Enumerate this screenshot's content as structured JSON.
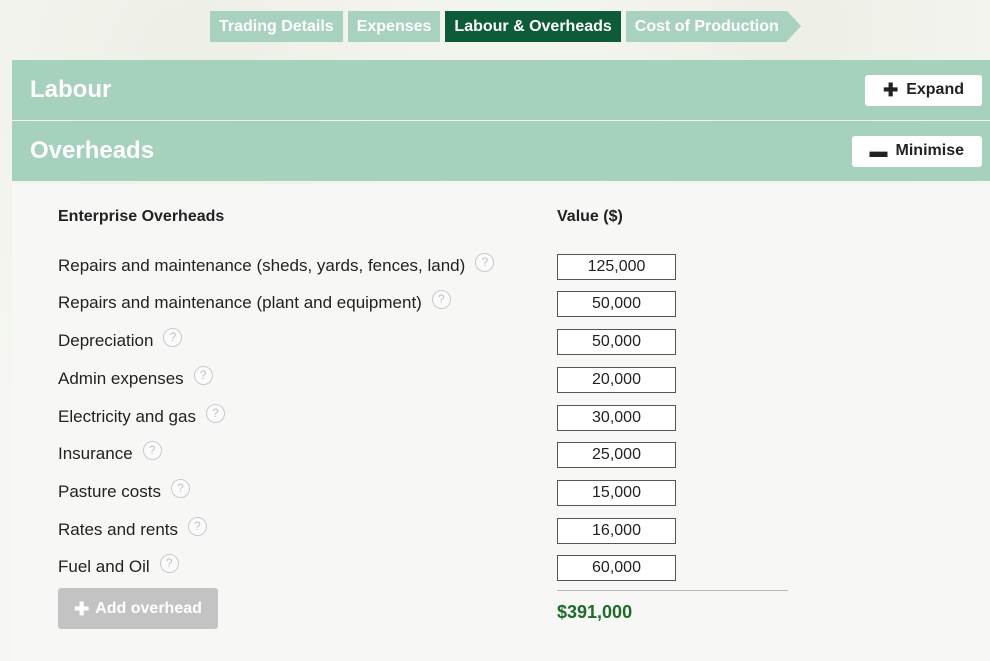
{
  "steps": [
    {
      "label": "Trading Details",
      "active": false
    },
    {
      "label": "Expenses",
      "active": false
    },
    {
      "label": "Labour & Overheads",
      "active": true
    },
    {
      "label": "Cost of Production",
      "active": false
    }
  ],
  "labour": {
    "title": "Labour",
    "button_label": "Expand",
    "button_icon": "plus-icon"
  },
  "overheads": {
    "title": "Overheads",
    "button_label": "Minimise",
    "button_icon": "minus-icon",
    "col_name": "Enterprise Overheads",
    "col_value": "Value ($)",
    "rows": [
      {
        "label": "Repairs and maintenance (sheds, yards, fences, land)",
        "value": "125,000"
      },
      {
        "label": "Repairs and maintenance (plant and equipment)",
        "value": "50,000"
      },
      {
        "label": "Depreciation",
        "value": "50,000"
      },
      {
        "label": "Admin expenses",
        "value": "20,000"
      },
      {
        "label": "Electricity and gas",
        "value": "30,000"
      },
      {
        "label": "Insurance",
        "value": "25,000"
      },
      {
        "label": "Pasture costs",
        "value": "15,000"
      },
      {
        "label": "Rates and rents",
        "value": "16,000"
      },
      {
        "label": "Fuel and Oil",
        "value": "60,000"
      }
    ],
    "help_glyph": "?",
    "add_label": "Add overhead",
    "total": "$391,000"
  },
  "colors": {
    "tab_inactive": "#a8d2bf",
    "tab_active": "#0e5b3a",
    "bar": "#a6d1bd",
    "total_text": "#1f6b2b"
  }
}
